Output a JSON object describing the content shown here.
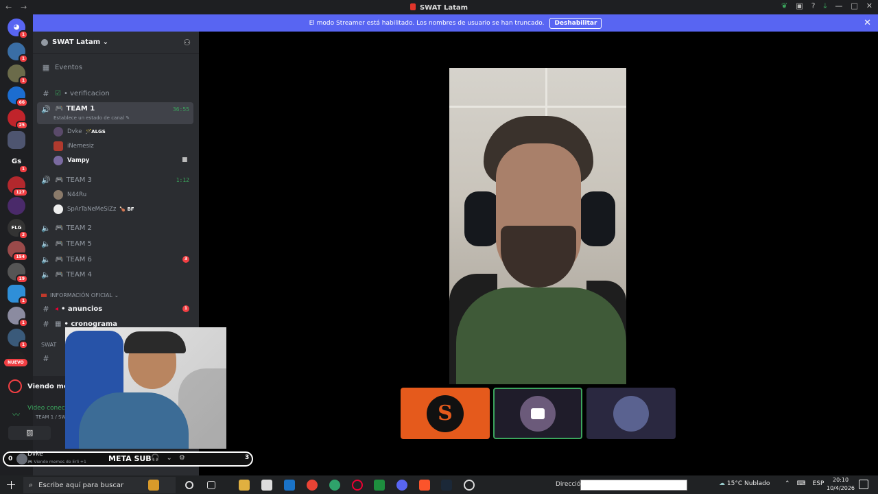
{
  "window": {
    "title": "SWAT Latam",
    "back": "←",
    "forward": "→",
    "controls": [
      "—",
      "□",
      "✕"
    ]
  },
  "banner": {
    "text": "El modo Streamer está habilitado. Los nombres de usuario se han truncado.",
    "button": "Deshabilitar",
    "close": "✕"
  },
  "guilds": {
    "badges": [
      "1",
      "1",
      "1",
      "66",
      "25",
      "1",
      "127",
      "2",
      "154",
      "19",
      "1",
      "1",
      "1"
    ],
    "labels": {
      "gs": "Gs",
      "flg": "FLG"
    },
    "nuevo": "NUEVO"
  },
  "server": {
    "name": "SWAT Latam ⌄",
    "events": "Eventos"
  },
  "channels": {
    "verificacion": "• verificacion",
    "team1": {
      "name": "TEAM 1",
      "time": "36:55",
      "status": "Establece un estado de canal ✎"
    },
    "team1_users": [
      {
        "name": "Dvke",
        "tag": "🪄ALGS"
      },
      {
        "name": "iNemesiz",
        "tag": ""
      },
      {
        "name": "Vampy",
        "tag": ""
      }
    ],
    "team3": {
      "name": "TEAM 3",
      "time": "1:12"
    },
    "team3_users": [
      {
        "name": "N44Ru",
        "tag": ""
      },
      {
        "name": "SpArTaNeMeSiZz",
        "tag": "🍗 BF"
      }
    ],
    "team2": "TEAM 2",
    "team5": "TEAM 5",
    "team6": {
      "name": "TEAM 6",
      "badge": "3"
    },
    "team4": "TEAM 4",
    "section_info": "INFORMACIÓN OFICIAL ⌄",
    "anuncios": {
      "name": "• anuncios",
      "badge": "1"
    },
    "cronograma": "• cronograma",
    "section_swat": "SWAT"
  },
  "voice_panel": {
    "viewing": "Viendo mem",
    "video": "Video conec",
    "video_sub": "TEAM 1 / SW"
  },
  "userbar": {
    "left_num": "0",
    "username": "Dvke",
    "status": "🎮 Viendo memes de Erli +1",
    "meta": "META SUB",
    "right_num": "3"
  },
  "taskbar": {
    "search": "Escribe aquí para buscar",
    "address_label": "Dirección",
    "weather": "15°C  Nublado",
    "lang": "ESP",
    "time": "20:10",
    "date": "10/4/2026"
  }
}
